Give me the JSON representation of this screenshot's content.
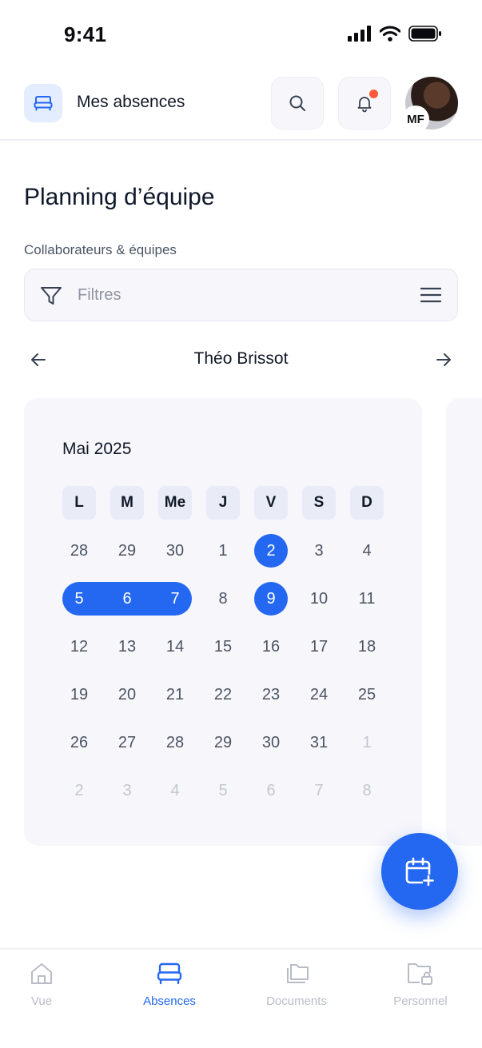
{
  "status_bar": {
    "time": "9:41"
  },
  "header": {
    "title": "Mes absences",
    "avatar_initials": "MF"
  },
  "page": {
    "title": "Planning d’équipe",
    "filter_label": "Collaborateurs & équipes",
    "filter_placeholder": "Filtres",
    "person_name": "Théo Brissot"
  },
  "calendar": {
    "month_label": "Mai 2025",
    "weekdays": [
      "L",
      "M",
      "Me",
      "J",
      "V",
      "S",
      "D"
    ],
    "days": [
      {
        "label": "28",
        "muted": false
      },
      {
        "label": "29",
        "muted": false
      },
      {
        "label": "30",
        "muted": false
      },
      {
        "label": "1",
        "muted": false
      },
      {
        "label": "2",
        "muted": false,
        "selected": "single"
      },
      {
        "label": "3",
        "muted": false
      },
      {
        "label": "4",
        "muted": false
      },
      {
        "label": "5",
        "muted": false,
        "selected": "range"
      },
      {
        "label": "6",
        "muted": false,
        "selected": "range"
      },
      {
        "label": "7",
        "muted": false,
        "selected": "range"
      },
      {
        "label": "8",
        "muted": false
      },
      {
        "label": "9",
        "muted": false,
        "selected": "single"
      },
      {
        "label": "10",
        "muted": false
      },
      {
        "label": "11",
        "muted": false
      },
      {
        "label": "12",
        "muted": false
      },
      {
        "label": "13",
        "muted": false
      },
      {
        "label": "14",
        "muted": false
      },
      {
        "label": "15",
        "muted": false
      },
      {
        "label": "16",
        "muted": false
      },
      {
        "label": "17",
        "muted": false
      },
      {
        "label": "18",
        "muted": false
      },
      {
        "label": "19",
        "muted": false
      },
      {
        "label": "20",
        "muted": false
      },
      {
        "label": "21",
        "muted": false
      },
      {
        "label": "22",
        "muted": false
      },
      {
        "label": "23",
        "muted": false
      },
      {
        "label": "24",
        "muted": false
      },
      {
        "label": "25",
        "muted": false
      },
      {
        "label": "26",
        "muted": false
      },
      {
        "label": "27",
        "muted": false
      },
      {
        "label": "28",
        "muted": false
      },
      {
        "label": "29",
        "muted": false
      },
      {
        "label": "30",
        "muted": false
      },
      {
        "label": "31",
        "muted": false
      },
      {
        "label": "1",
        "muted": true
      },
      {
        "label": "2",
        "muted": true
      },
      {
        "label": "3",
        "muted": true
      },
      {
        "label": "4",
        "muted": true
      },
      {
        "label": "5",
        "muted": true
      },
      {
        "label": "6",
        "muted": true
      },
      {
        "label": "7",
        "muted": true
      },
      {
        "label": "8",
        "muted": true
      }
    ]
  },
  "tabbar": {
    "tabs": [
      {
        "label": "Vue",
        "icon": "home-icon",
        "active": false
      },
      {
        "label": "Absences",
        "icon": "bed-icon",
        "active": true
      },
      {
        "label": "Documents",
        "icon": "folders-icon",
        "active": false
      },
      {
        "label": "Personnel",
        "icon": "folder-lock-icon",
        "active": false
      }
    ]
  },
  "colors": {
    "accent": "#2468f2",
    "notification": "#fb5b3a",
    "card_bg": "#f6f6fb"
  }
}
